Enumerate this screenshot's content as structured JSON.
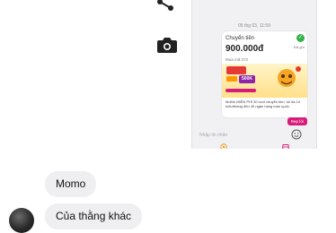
{
  "embedded_screenshot": {
    "timestamp": "05 thg 03, 11:59",
    "card": {
      "title": "Chuyển tiền",
      "status": "Đã gửi",
      "amount": "900.000đ",
      "code": "Mua mã 272",
      "banner_big": "500K",
      "promo": "MoMo MIỄN PHÍ 30 lượt chuyển tiền, tối đa 10 triệu/tháng đến 45 ngân hàng toàn quốc"
    },
    "reply_label": "Rep lời",
    "input_placeholder": "Nhập tin nhắn"
  },
  "messages": [
    {
      "text": "Momo"
    },
    {
      "text": "Của thằng khác"
    }
  ],
  "colors": {
    "accent": "#d81b7a",
    "bubble": "#efeff1",
    "check": "#35b34a"
  }
}
